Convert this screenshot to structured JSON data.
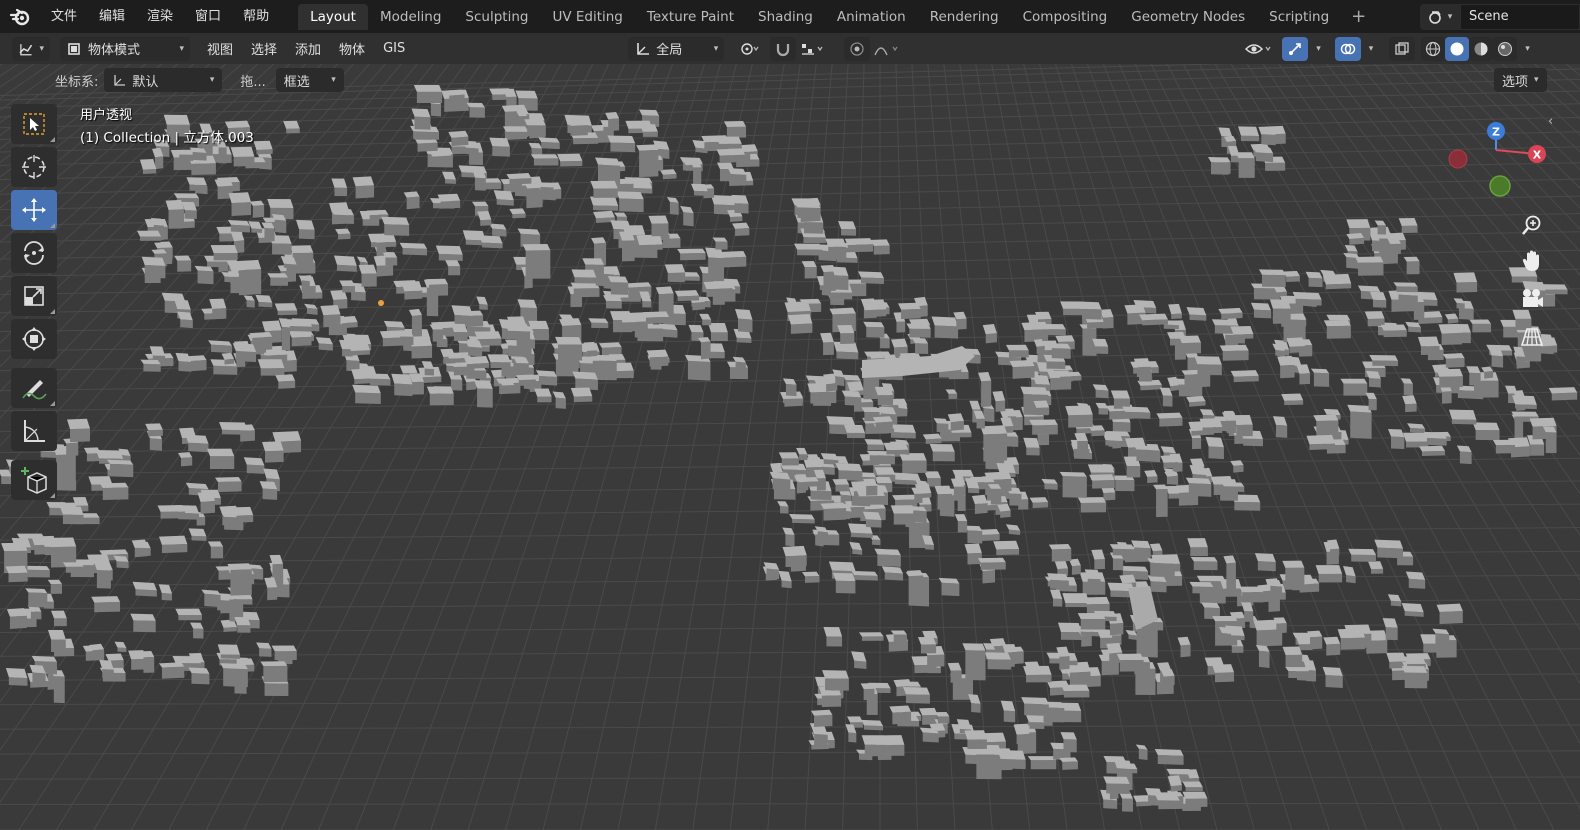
{
  "app": "Blender",
  "menu": {
    "file": "文件",
    "edit": "编辑",
    "render": "渲染",
    "window": "窗口",
    "help": "帮助"
  },
  "workspaces": [
    {
      "label": "Layout",
      "active": true
    },
    {
      "label": "Modeling"
    },
    {
      "label": "Sculpting"
    },
    {
      "label": "UV Editing"
    },
    {
      "label": "Texture Paint"
    },
    {
      "label": "Shading"
    },
    {
      "label": "Animation"
    },
    {
      "label": "Rendering"
    },
    {
      "label": "Compositing"
    },
    {
      "label": "Geometry Nodes"
    },
    {
      "label": "Scripting"
    }
  ],
  "add_workspace_label": "+",
  "scene": {
    "name": "Scene"
  },
  "header": {
    "mode": "物体模式",
    "view": "视图",
    "select": "选择",
    "add": "添加",
    "object": "物体",
    "gis": "GIS",
    "transform_orientation": "全局"
  },
  "toolrow": {
    "coord_label": "坐标系:",
    "coord_value": "默认",
    "drag_label": "拖...",
    "select_mode": "框选",
    "options": "选项"
  },
  "viewport": {
    "view_name": "用户透视",
    "collection_info": "(1) Collection | 立方体.003"
  },
  "gizmo": {
    "z": "Z",
    "x": "X"
  },
  "colors": {
    "topbar": "#1d1d1d",
    "header": "#303030",
    "accent_blue": "#4772b3",
    "viewport_bg": "#3a3a3a",
    "grid": "#4a4a4a",
    "building": "#b4b4b4"
  },
  "icons": {
    "tools": [
      "select-box-icon",
      "cursor-icon",
      "move-icon",
      "rotate-icon",
      "scale-icon",
      "transform-icon",
      "annotate-icon",
      "measure-icon",
      "add-cube-icon"
    ],
    "nav": [
      "zoom-icon",
      "hand-pan-icon",
      "camera-icon",
      "perspective-grid-icon"
    ]
  }
}
